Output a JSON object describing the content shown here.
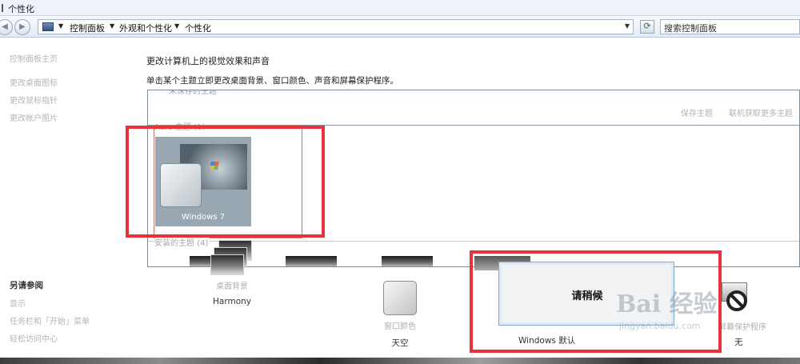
{
  "window": {
    "title": "个性化"
  },
  "address_bar": {
    "breadcrumbs": [
      "控制面板",
      "外观和个性化",
      "个性化"
    ],
    "search_placeholder": "搜索控制面板",
    "refresh_icon": "refresh-icon",
    "back_icon": "back-arrow-icon",
    "forward_icon": "forward-arrow-icon"
  },
  "sidebar": {
    "home_link": "控制面板主页",
    "items": [
      "更改桌面图标",
      "更改鼠标指针",
      "更改帐户图片"
    ],
    "see_also_heading": "另请参阅",
    "see_also_items": [
      "显示",
      "任务栏和「开始」菜单",
      "轻松访问中心"
    ]
  },
  "main": {
    "heading": "更改计算机上的视觉效果和声音",
    "subheading": "单击某个主题立即更改桌面背景、窗口颜色、声音和屏幕保护程序。",
    "my_themes_heading_cut": "未保存的主题",
    "save_theme": "保存主题",
    "get_more_themes": "联机获取更多主题",
    "aero_group_label": "Aero 主题 (1)",
    "installed_group_label": "安装的主题 (4)",
    "selected_theme": {
      "name": "Windows 7"
    }
  },
  "bottom_bar": {
    "desktop_background": {
      "label": "桌面背景",
      "value": "Harmony"
    },
    "window_color": {
      "label": "窗口颜色",
      "value": "天空"
    },
    "sounds": {
      "value": "Windows 默认"
    },
    "screen_saver": {
      "label": "屏幕保护程序",
      "value": "无"
    }
  },
  "dialog": {
    "text": "请稍候"
  },
  "watermark": {
    "line1": "Bai 经验",
    "line2": "jingyan.baidu.com"
  },
  "colors": {
    "annotation": "#e8323c",
    "accent": "#87a7c9"
  }
}
